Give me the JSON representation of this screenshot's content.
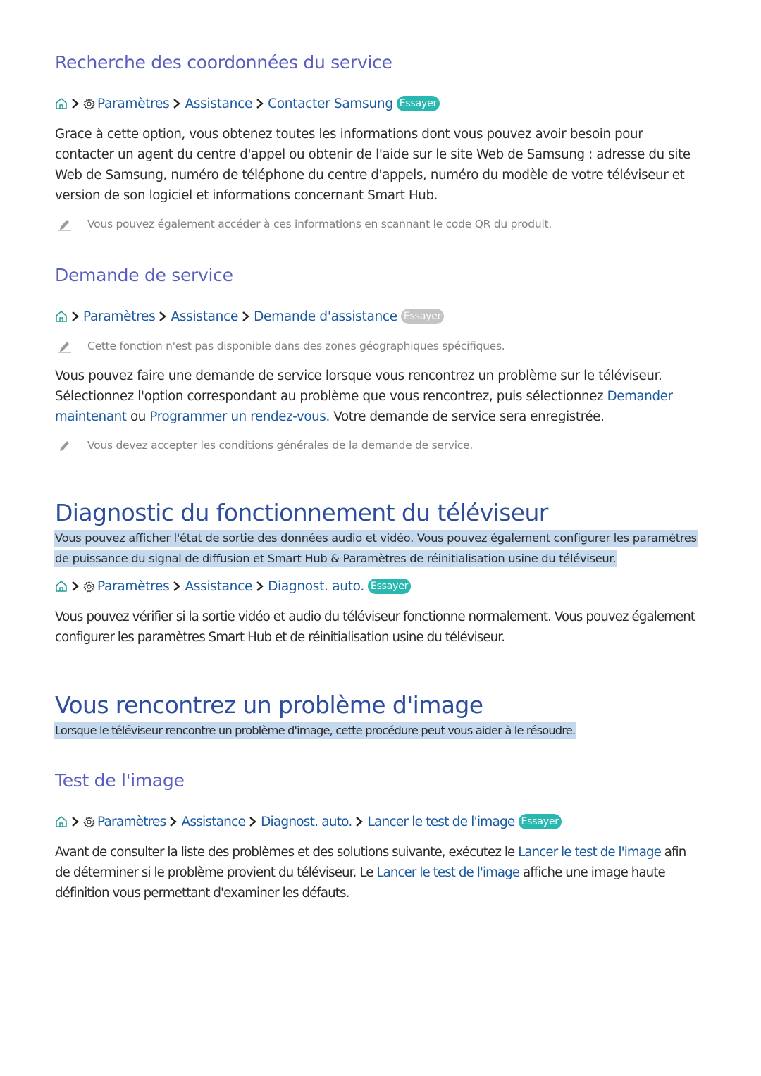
{
  "sections": {
    "contact": {
      "heading": "Recherche des coordonnées du service",
      "breadcrumb": {
        "icons": [
          "home-icon",
          "gear-icon"
        ],
        "items": [
          "Paramètres",
          "Assistance",
          "Contacter Samsung"
        ],
        "try_label": "Essayer",
        "try_enabled": true
      },
      "body": "Grace à cette option, vous obtenez toutes les informations dont vous pouvez avoir besoin pour contacter un agent du centre d'appel ou obtenir de l'aide sur le site Web de Samsung : adresse du site Web de Samsung, numéro de téléphone du centre d'appels, numéro du modèle de votre téléviseur et version de son logiciel et informations concernant Smart Hub.",
      "note": "Vous pouvez également accéder à ces informations en scannant le code QR du produit."
    },
    "service_request": {
      "heading": "Demande de service",
      "breadcrumb": {
        "icons": [
          "home-icon"
        ],
        "items": [
          "Paramètres",
          "Assistance",
          "Demande d'assistance"
        ],
        "try_label": "Essayer",
        "try_enabled": false
      },
      "note1": "Cette fonction n'est pas disponible dans des zones géographiques spécifiques.",
      "body_part1": "Vous pouvez faire une demande de service lorsque vous rencontrez un problème sur le téléviseur. Sélectionnez l'option correspondant au problème que vous rencontrez, puis sélectionnez ",
      "link1": "Demander maintenant",
      "body_part2": " ou ",
      "link2": "Programmer un rendez-vous",
      "body_part3": ". Votre demande de service sera enregistrée.",
      "note2": "Vous devez accepter les conditions générales de la demande de service."
    },
    "diagnostic": {
      "title": "Diagnostic du fonctionnement du téléviseur",
      "highlight_line1": "Vous pouvez afficher l'état de sortie des données audio et vidéo. Vous pouvez également configurer les paramètres",
      "highlight_line2": "de puissance du signal de diffusion et Smart Hub & Paramètres de réinitialisation usine du téléviseur.",
      "breadcrumb": {
        "icons": [
          "home-icon",
          "gear-icon"
        ],
        "items": [
          "Paramètres",
          "Assistance",
          "Diagnost. auto."
        ],
        "try_label": "Essayer",
        "try_enabled": true
      },
      "body": "Vous pouvez vérifier si la sortie vidéo et audio du téléviseur fonctionne normalement. Vous pouvez également configurer les paramètres Smart Hub et de réinitialisation usine du téléviseur."
    },
    "picture_problem": {
      "title": "Vous rencontrez un problème d'image",
      "highlight": "Lorsque le téléviseur rencontre un problème d'image, cette procédure peut vous aider à le résoudre."
    },
    "picture_test": {
      "heading": "Test de l'image",
      "breadcrumb": {
        "icons": [
          "home-icon",
          "gear-icon"
        ],
        "items": [
          "Paramètres",
          "Assistance",
          "Diagnost. auto.",
          "Lancer le test de l'image"
        ],
        "try_label": "Essayer",
        "try_enabled": true
      },
      "body_part1": "Avant de consulter la liste des problèmes et des solutions suivante, exécutez le ",
      "link1": "Lancer le test de l'image",
      "body_part2": " afin de déterminer si le problème provient du téléviseur. Le ",
      "link2": "Lancer le test de l'image",
      "body_part3": " affiche une image haute définition vous permettant d'examiner les défauts."
    }
  },
  "colors": {
    "heading": "#5a5fbf",
    "title": "#2d4e9e",
    "link": "#1a5aa0",
    "try_active": "#28b8b0",
    "try_disabled": "#c4c4c4",
    "highlight": "#c5d9ee"
  }
}
